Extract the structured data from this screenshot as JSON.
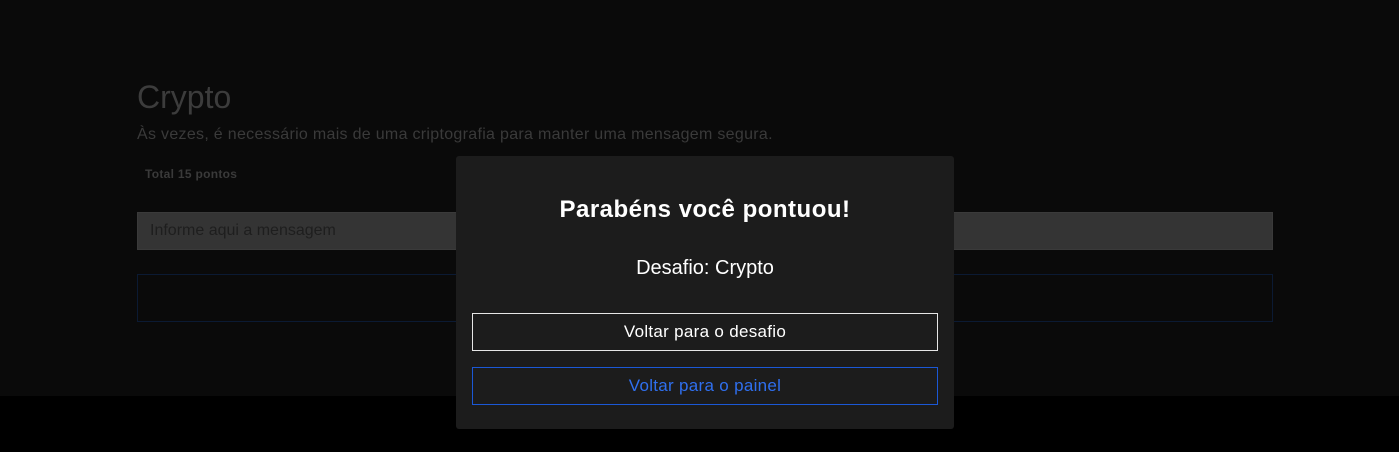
{
  "challenge": {
    "title": "Crypto",
    "description": "Às vezes, é necessário mais de uma criptografia para manter uma mensagem segura.",
    "points": "Total 15 pontos",
    "input_placeholder": "Informe aqui a mensagem"
  },
  "modal": {
    "title": "Parabéns você pontuou!",
    "challenge_label": "Desafio: Crypto",
    "back_to_challenge": "Voltar para o desafio",
    "back_to_panel": "Voltar para o painel"
  },
  "colors": {
    "modal_background": "#1c1c1c",
    "accent_blue": "#2f6fee",
    "page_background": "#0a0a0a"
  }
}
